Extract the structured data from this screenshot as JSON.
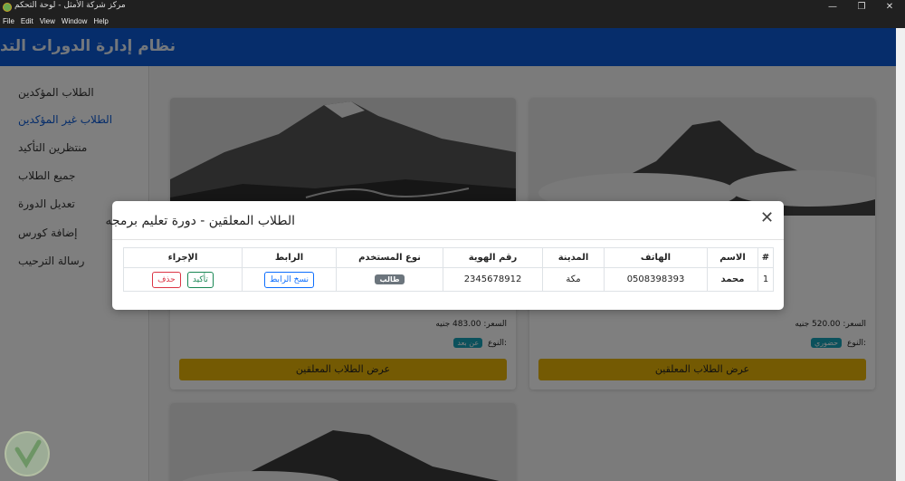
{
  "window": {
    "title": "مركز شركة الأمثل - لوحة التحكم",
    "controls": {
      "minimize": "—",
      "maximize": "❐",
      "close": "✕"
    }
  },
  "menu": [
    "File",
    "Edit",
    "View",
    "Window",
    "Help"
  ],
  "header": {
    "title": "نظام إدارة الدورات التدريبية"
  },
  "sidebar": {
    "items": [
      {
        "label": "الطلاب المؤكدين",
        "active": false
      },
      {
        "label": "الطلاب غير المؤكدين",
        "active": true
      },
      {
        "label": "منتظرين التأكيد",
        "active": false
      },
      {
        "label": "جميع الطلاب",
        "active": false
      },
      {
        "label": "تعديل الدورة",
        "active": false
      },
      {
        "label": "إضافة كورس",
        "active": false
      },
      {
        "label": "رسالة الترحيب",
        "active": false
      }
    ]
  },
  "cards": [
    {
      "price": "السعر: 483.00 جنيه",
      "type_label": ":النوع",
      "type_value": "عن بعد",
      "button": "عرض الطلاب المعلقين"
    },
    {
      "price": "السعر: 520.00 جنيه",
      "type_label": ":النوع",
      "type_value": "حضوري",
      "button": "عرض الطلاب المعلقين"
    }
  ],
  "modal": {
    "title": "الطلاب المعلقين - دورة تعليم برمجه",
    "close_icon": "close-icon",
    "table": {
      "headers": [
        "#",
        "الاسم",
        "الهاتف",
        "المدينة",
        "رقم الهوية",
        "نوع المستخدم",
        "الرابط",
        "الإجراء"
      ],
      "rows": [
        {
          "index": "1",
          "name": "محمد",
          "phone": "0508398393",
          "city": "مكة",
          "id_number": "2345678912",
          "user_type": "طالب",
          "link_button": "نسخ الرابط",
          "confirm_button": "تأكيد",
          "delete_button": "حذف"
        }
      ]
    }
  },
  "colors": {
    "header_blue": "#0d5bd6",
    "yellow_button": "#e8b406",
    "badge_info": "#17a2b8",
    "badge_secondary": "#6c757d"
  }
}
